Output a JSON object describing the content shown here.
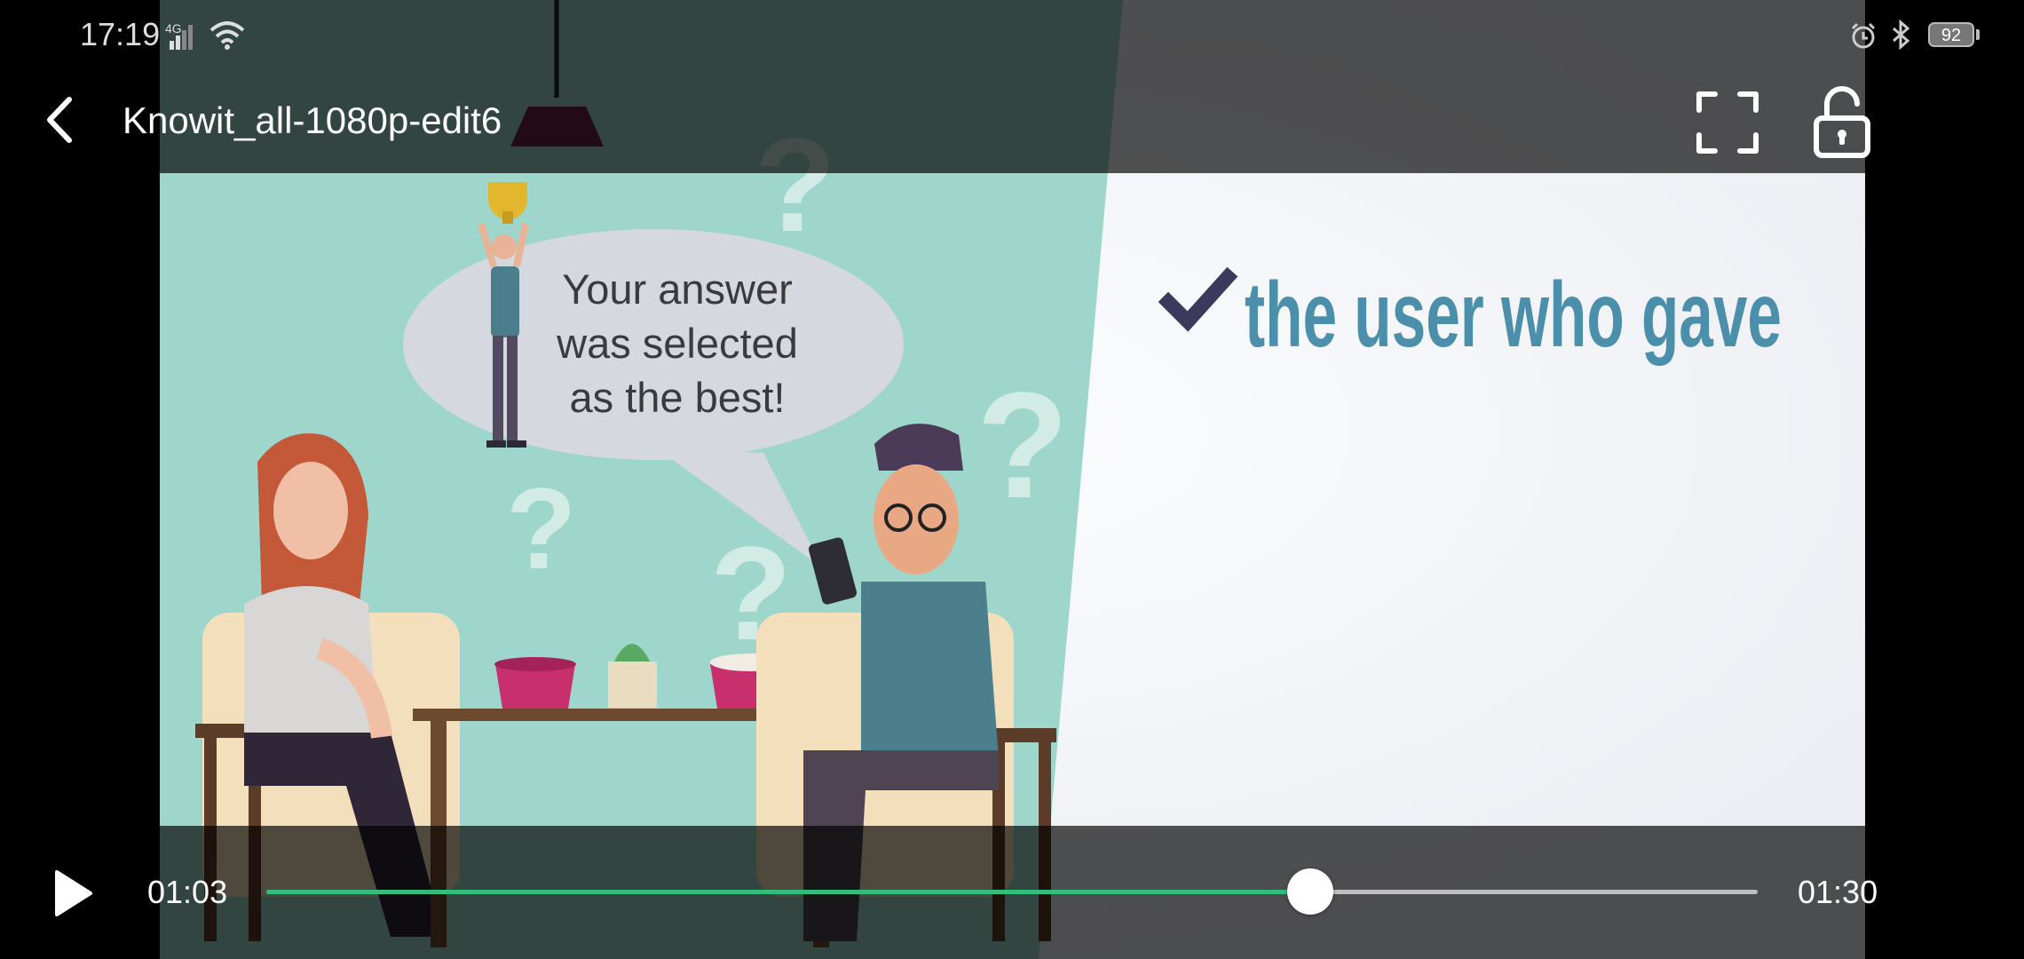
{
  "status_bar": {
    "time": "17:19",
    "network": "4G",
    "battery": "92"
  },
  "player": {
    "title": "Knowit_all-1080p-edit6",
    "current_time": "01:03",
    "total_time": "01:30",
    "progress": 0.7,
    "accent_color": "#2fbf7a"
  },
  "video_frame": {
    "speech_bubble": [
      "Your answer",
      "was selected",
      "as the best!"
    ],
    "headline": "the user who gave"
  },
  "icons": {
    "back": "back-arrow-icon",
    "fullscreen": "fullscreen-icon",
    "lock": "unlock-icon",
    "play": "play-icon"
  }
}
